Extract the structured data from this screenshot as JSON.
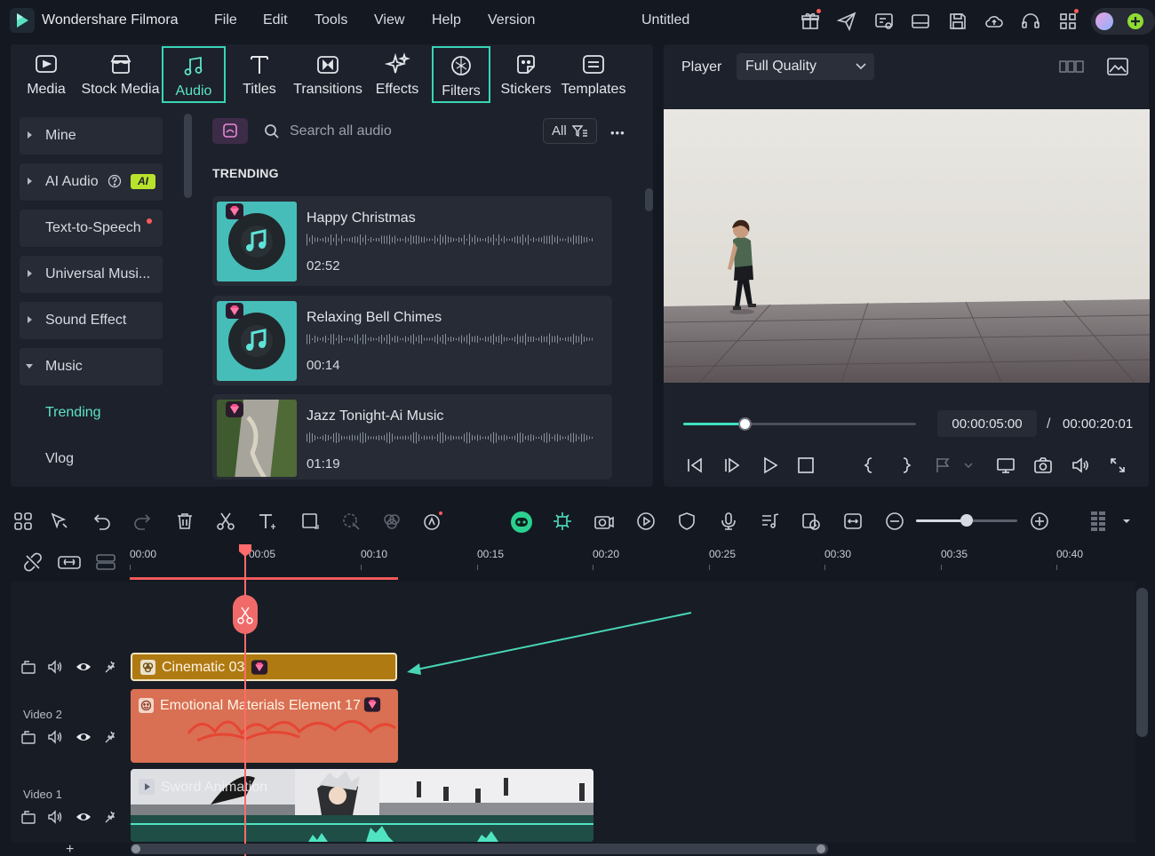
{
  "app": {
    "name": "Wondershare Filmora",
    "project_title": "Untitled"
  },
  "menu": [
    "File",
    "Edit",
    "Tools",
    "View",
    "Help",
    "Version"
  ],
  "tabs": [
    {
      "label": "Media",
      "icon": "media-icon"
    },
    {
      "label": "Stock Media",
      "icon": "stock-media-icon"
    },
    {
      "label": "Audio",
      "icon": "music-note-icon",
      "active": true
    },
    {
      "label": "Titles",
      "icon": "text-t-icon"
    },
    {
      "label": "Transitions",
      "icon": "transitions-icon"
    },
    {
      "label": "Effects",
      "icon": "effects-sparkle-icon"
    },
    {
      "label": "Filters",
      "icon": "filters-icon",
      "highlighted": true
    },
    {
      "label": "Stickers",
      "icon": "stickers-icon"
    },
    {
      "label": "Templates",
      "icon": "templates-icon"
    }
  ],
  "categories": {
    "mine": "Mine",
    "ai_audio": "AI Audio",
    "ai_badge": "AI",
    "tts": "Text-to-Speech",
    "universal": "Universal Musi...",
    "sound_effect": "Sound Effect",
    "music": "Music",
    "trending": "Trending",
    "vlog": "Vlog"
  },
  "search": {
    "placeholder": "Search all audio",
    "filter_label": "All",
    "more": "•••"
  },
  "trending_heading": "TRENDING",
  "audio_items": [
    {
      "title": "Happy Christmas",
      "duration": "02:52"
    },
    {
      "title": "Relaxing Bell Chimes",
      "duration": "00:14"
    },
    {
      "title": "Jazz Tonight-Ai Music",
      "duration": "01:19"
    }
  ],
  "player": {
    "label": "Player",
    "quality": "Full Quality",
    "current_time": "00:00:05:00",
    "separator": "/",
    "total_time": "00:00:20:01",
    "progress": 0.25
  },
  "timeline": {
    "ticks": [
      "00:00",
      "00:05",
      "00:10",
      "00:15",
      "00:20",
      "00:25",
      "00:30",
      "00:35",
      "00:40"
    ],
    "tracks": {
      "video2": "Video 2",
      "video1": "Video 1"
    },
    "clips": {
      "filter": "Cinematic 03",
      "element": "Emotional Materials Element 17",
      "video": "Sword Animation"
    },
    "add_track": "+"
  },
  "colors": {
    "accent": "#38d6b7",
    "filter_clip": "#b07a12",
    "element_clip": "#d96f53",
    "playhead": "#ff6b6b"
  }
}
